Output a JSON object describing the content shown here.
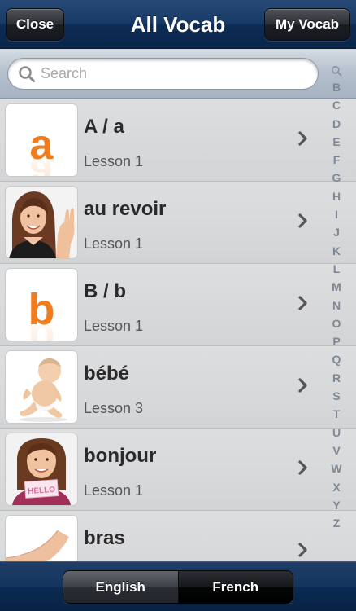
{
  "navbar": {
    "close_label": "Close",
    "title": "All Vocab",
    "my_vocab_label": "My Vocab"
  },
  "search": {
    "placeholder": "Search"
  },
  "items": [
    {
      "word": "A / a",
      "lesson": "Lesson 1",
      "image": "letter-a"
    },
    {
      "word": "au revoir",
      "lesson": "Lesson 1",
      "image": "woman-waving"
    },
    {
      "word": "B / b",
      "lesson": "Lesson 1",
      "image": "letter-b"
    },
    {
      "word": "bébé",
      "lesson": "Lesson 3",
      "image": "baby"
    },
    {
      "word": "bonjour",
      "lesson": "Lesson 1",
      "image": "girl-hello-sign"
    },
    {
      "word": "bras",
      "lesson": "",
      "image": "arm"
    }
  ],
  "index_letters": [
    "B",
    "C",
    "D",
    "E",
    "F",
    "G",
    "H",
    "I",
    "J",
    "K",
    "L",
    "M",
    "N",
    "O",
    "P",
    "Q",
    "R",
    "S",
    "T",
    "U",
    "V",
    "W",
    "X",
    "Y",
    "Z"
  ],
  "toolbar": {
    "english_label": "English",
    "french_label": "French"
  },
  "colors": {
    "navbar": "#173a66",
    "letter_orange": "#f07c1e",
    "index_text": "#7d8796"
  }
}
